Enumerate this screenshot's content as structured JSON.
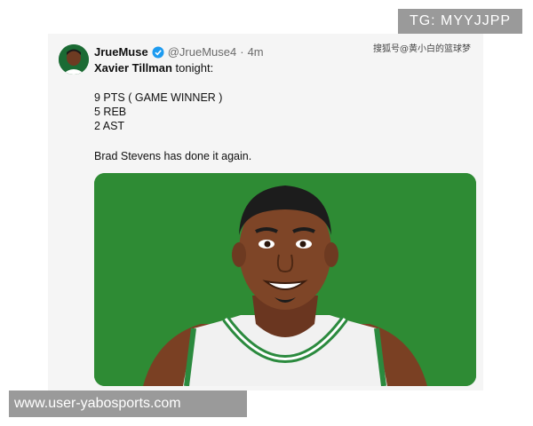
{
  "tweet": {
    "author_name": "JrueMuse",
    "author_handle": "@JrueMuse4",
    "separator": "·",
    "timestamp": "4m",
    "line1_player": "Xavier Tillman",
    "line1_rest": " tonight:",
    "stats": [
      "9 PTS ( GAME WINNER )",
      "5 REB",
      "2 AST"
    ],
    "quote": "Brad Stevens has done it again."
  },
  "watermarks": {
    "telegram": "TG: MYYJJPP",
    "chinese_source": "搜狐号@黄小白的篮球梦",
    "url": "www.user-yabosports.com"
  },
  "icons": {
    "verified": "verified-badge-icon",
    "avatar": "avatar"
  },
  "colors": {
    "media_background": "#2e8b34",
    "avatar_background": "#1b6b34",
    "verified": "#1d9bf0",
    "watermark_badge": "#9a9a9a"
  }
}
